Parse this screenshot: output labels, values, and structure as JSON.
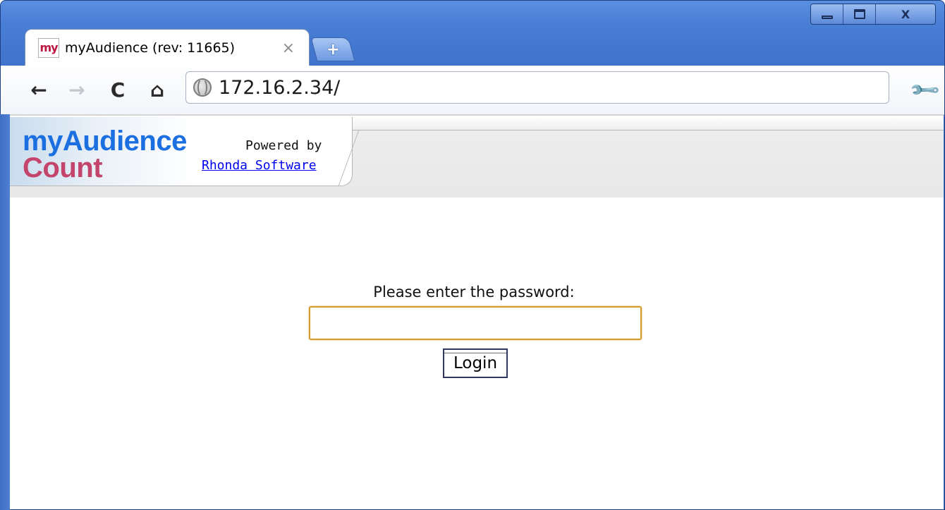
{
  "window": {
    "controls": [
      "minimize",
      "maximize",
      "close"
    ],
    "close_glyph": "X"
  },
  "tab": {
    "favicon_text": "my",
    "title": "myAudience (rev: 11665)",
    "close_glyph": "×",
    "new_tab_glyph": "+"
  },
  "toolbar": {
    "back_glyph": "←",
    "forward_glyph": "→",
    "reload_glyph": "C",
    "home_glyph": "⌂",
    "wrench_glyph": "🔧",
    "url": "172.16.2.34/"
  },
  "header": {
    "logo_top": "myAudience",
    "logo_bottom": "Count",
    "powered_by": "Powered by",
    "vendor_link": "Rhonda Software"
  },
  "login": {
    "prompt": "Please enter the password:",
    "password_value": "",
    "button_label": "Login"
  },
  "colors": {
    "logo_blue": "#1c6fe0",
    "logo_red": "#c4456b",
    "focus_border": "#d49b2c",
    "frame_blue": "#4a7fd6",
    "link": "#0000ee"
  }
}
